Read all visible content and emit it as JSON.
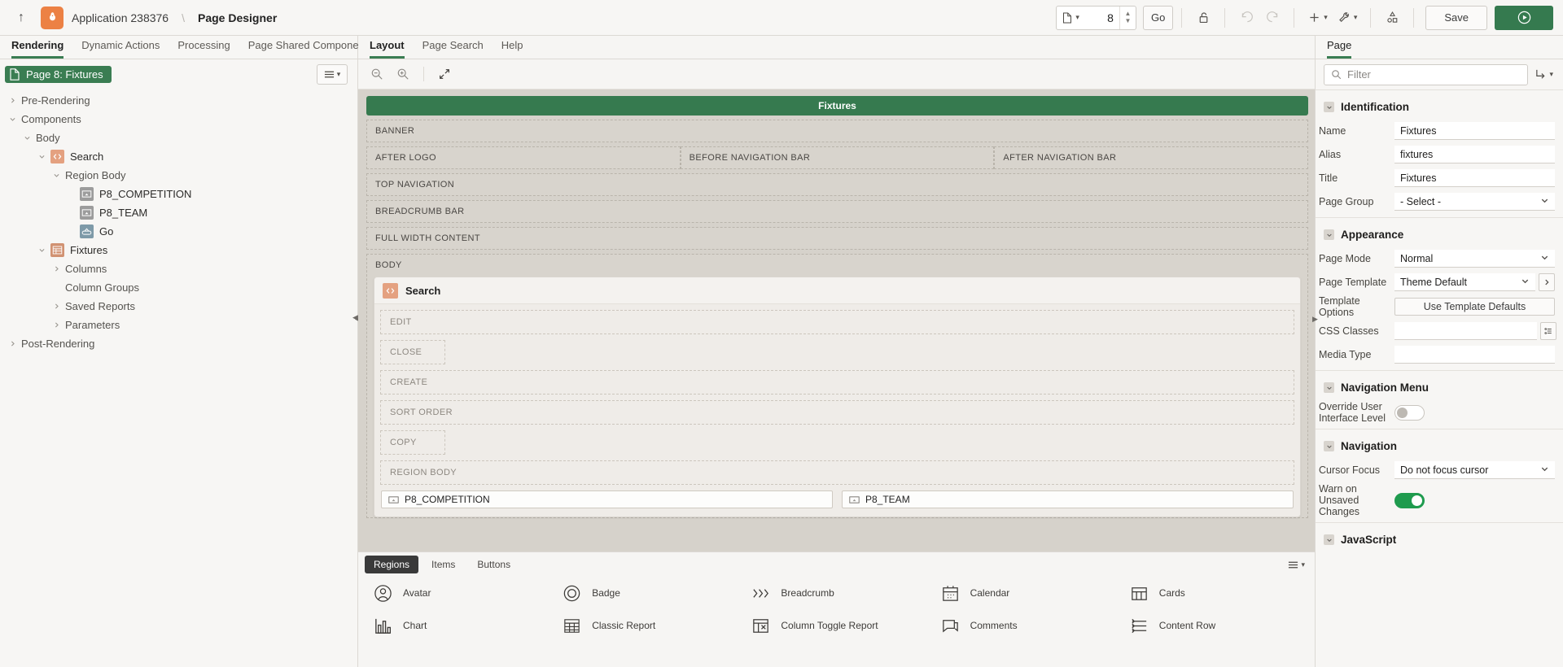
{
  "topbar": {
    "back_icon": "up-arrow-icon",
    "app_label": "Application 238376",
    "separator": "\\",
    "current": "Page Designer",
    "page_number": "8",
    "go_label": "Go",
    "save_label": "Save",
    "icons": [
      "page-select-icon",
      "lock-icon",
      "undo-icon",
      "redo-icon",
      "add-icon",
      "utilities-icon",
      "shared-components-icon",
      "run-icon"
    ]
  },
  "left": {
    "tabs": [
      {
        "label": "Rendering",
        "active": true
      },
      {
        "label": "Dynamic Actions",
        "active": false
      },
      {
        "label": "Processing",
        "active": false
      },
      {
        "label": "Page Shared Components",
        "active": false
      }
    ],
    "page_pill": "Page 8: Fixtures",
    "tree": [
      {
        "label": "Pre-Rendering",
        "depth": 0,
        "toggle": "collapsed",
        "icon": "none",
        "dim": true
      },
      {
        "label": "Components",
        "depth": 0,
        "toggle": "expanded",
        "icon": "none",
        "dim": true
      },
      {
        "label": "Body",
        "depth": 1,
        "toggle": "expanded",
        "icon": "none",
        "dim": true
      },
      {
        "label": "Search",
        "depth": 2,
        "toggle": "expanded",
        "icon": "code-region-icon",
        "dim": false
      },
      {
        "label": "Region Body",
        "depth": 3,
        "toggle": "expanded",
        "icon": "none",
        "dim": true
      },
      {
        "label": "P8_COMPETITION",
        "depth": 4,
        "toggle": "none",
        "icon": "item-icon",
        "dim": false
      },
      {
        "label": "P8_TEAM",
        "depth": 4,
        "toggle": "none",
        "icon": "item-icon",
        "dim": false
      },
      {
        "label": "Go",
        "depth": 4,
        "toggle": "none",
        "icon": "button-icon",
        "dim": false
      },
      {
        "label": "Fixtures",
        "depth": 2,
        "toggle": "expanded",
        "icon": "report-icon",
        "dim": false
      },
      {
        "label": "Columns",
        "depth": 3,
        "toggle": "collapsed",
        "icon": "none",
        "dim": true
      },
      {
        "label": "Column Groups",
        "depth": 3,
        "toggle": "none",
        "icon": "none",
        "dim": true
      },
      {
        "label": "Saved Reports",
        "depth": 3,
        "toggle": "collapsed",
        "icon": "none",
        "dim": true
      },
      {
        "label": "Parameters",
        "depth": 3,
        "toggle": "collapsed",
        "icon": "none",
        "dim": true
      },
      {
        "label": "Post-Rendering",
        "depth": 0,
        "toggle": "collapsed",
        "icon": "none",
        "dim": true
      }
    ]
  },
  "center": {
    "tabs": [
      {
        "label": "Layout",
        "active": true
      },
      {
        "label": "Page Search",
        "active": false
      },
      {
        "label": "Help",
        "active": false
      }
    ],
    "tools": [
      "zoom-out-icon",
      "zoom-in-icon",
      "expand-icon"
    ],
    "region_title": "Fixtures",
    "slots_top": [
      "BANNER"
    ],
    "slots_nav_row": [
      "AFTER LOGO",
      "BEFORE NAVIGATION BAR",
      "AFTER NAVIGATION BAR"
    ],
    "slots_mid": [
      "TOP NAVIGATION",
      "BREADCRUMB BAR",
      "FULL WIDTH CONTENT"
    ],
    "body_label": "BODY",
    "card_title": "Search",
    "card_slots": [
      "EDIT",
      "CLOSE",
      "CREATE",
      "SORT ORDER",
      "COPY",
      "REGION BODY"
    ],
    "fields": [
      "P8_COMPETITION",
      "P8_TEAM"
    ]
  },
  "gallery": {
    "tabs": [
      {
        "label": "Regions",
        "active": true
      },
      {
        "label": "Items",
        "active": false
      },
      {
        "label": "Buttons",
        "active": false
      }
    ],
    "items": [
      {
        "label": "Avatar",
        "icon": "avatar-icon"
      },
      {
        "label": "Badge",
        "icon": "badge-icon"
      },
      {
        "label": "Breadcrumb",
        "icon": "breadcrumb-icon"
      },
      {
        "label": "Calendar",
        "icon": "calendar-icon"
      },
      {
        "label": "Cards",
        "icon": "cards-icon"
      },
      {
        "label": "Chart",
        "icon": "chart-icon"
      },
      {
        "label": "Classic Report",
        "icon": "classic-report-icon"
      },
      {
        "label": "Column Toggle Report",
        "icon": "column-toggle-report-icon"
      },
      {
        "label": "Comments",
        "icon": "comments-icon"
      },
      {
        "label": "Content Row",
        "icon": "content-row-icon"
      }
    ]
  },
  "right": {
    "tab_label": "Page",
    "filter_placeholder": "Filter",
    "sections": [
      {
        "title": "Identification",
        "rows": [
          {
            "label": "Name",
            "type": "input",
            "value": "Fixtures"
          },
          {
            "label": "Alias",
            "type": "input",
            "value": "fixtures"
          },
          {
            "label": "Title",
            "type": "input",
            "value": "Fixtures"
          },
          {
            "label": "Page Group",
            "type": "select",
            "value": "- Select -"
          }
        ]
      },
      {
        "title": "Appearance",
        "rows": [
          {
            "label": "Page Mode",
            "type": "select",
            "value": "Normal"
          },
          {
            "label": "Page Template",
            "type": "select-btn",
            "value": "Theme Default"
          },
          {
            "label": "Template Options",
            "type": "button",
            "value": "Use Template Defaults"
          },
          {
            "label": "CSS Classes",
            "type": "input-btn",
            "value": ""
          },
          {
            "label": "Media Type",
            "type": "input",
            "value": ""
          }
        ]
      },
      {
        "title": "Navigation Menu",
        "rows": [
          {
            "label": "Override User Interface Level",
            "type": "toggle",
            "value": "off"
          }
        ]
      },
      {
        "title": "Navigation",
        "rows": [
          {
            "label": "Cursor Focus",
            "type": "select",
            "value": "Do not focus cursor"
          },
          {
            "label": "Warn on Unsaved Changes",
            "type": "toggle",
            "value": "on"
          }
        ]
      },
      {
        "title": "JavaScript",
        "rows": []
      }
    ]
  },
  "colors": {
    "accent_green": "#357a4f",
    "orange": "#ec8144",
    "toggle_on": "#1f9b4e",
    "region_header": "#367a4f"
  }
}
